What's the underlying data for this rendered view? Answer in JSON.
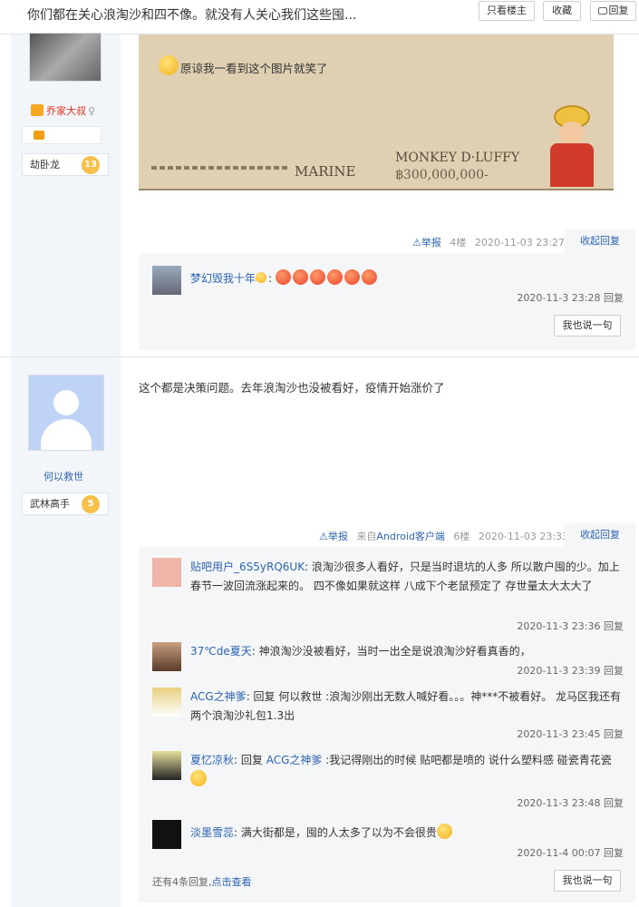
{
  "header": {
    "title": "你们都在关心浪淘沙和四不像。就没有人关心我们这些囤...",
    "only_author": "只看楼主",
    "favorite": "收藏",
    "reply": "回复"
  },
  "post1": {
    "username": "乔家大叔",
    "rank": "劫卧龙",
    "level": "13",
    "content": "原谅我一看到这个图片就笑了",
    "image_marine": "MARINE",
    "image_name": "MONKEY D·LUFFY",
    "image_bounty": "฿300,000,000-",
    "report": "举报",
    "floor": "4楼",
    "date": "2020-11-03 23:27",
    "collapse": "收起回复",
    "replies": [
      {
        "user": "梦幻毁我十年",
        "text": ":",
        "time": "2020-11-3 23:28",
        "reply_label": "回复"
      }
    ],
    "say_button": "我也说一句"
  },
  "post2": {
    "username": "何以救世",
    "rank": "武林高手",
    "level": "5",
    "content": "这个都是决策问题。去年浪淘沙也没被看好，疫情开始涨价了",
    "report": "举报",
    "source": "来自Android客户端",
    "floor": "6楼",
    "date": "2020-11-03 23:33",
    "collapse": "收起回复",
    "replies": [
      {
        "user": "贴吧用户_6S5yRQ6UK",
        "text": ": 浪淘沙很多人看好，只是当时退坑的人多 所以散户囤的少。加上春节一波回流涨起来的。 四不像如果就这样 八成下个老鼠预定了 存世量太大太大了",
        "time": "2020-11-3 23:36",
        "reply_label": "回复"
      },
      {
        "user": "37℃de夏天",
        "text": ": 神浪淘沙没被看好，当时一出全是说浪淘沙好看真香的，",
        "time": "2020-11-3 23:39",
        "reply_label": "回复"
      },
      {
        "user": "ACG之神爹",
        "text": ": 回复 何以救世 :浪淘沙刚出无数人喊好看。。。神***不被看好。 龙马区我还有两个浪淘沙礼包1.3出",
        "time": "2020-11-3 23:45",
        "reply_label": "回复"
      },
      {
        "user": "夏忆凉秋",
        "text": ": 回复 ",
        "mention": "ACG之神爹",
        "text2": " :我记得刚出的时候 贴吧都是喷的 说什么塑料感 碰瓷青花瓷",
        "time": "2020-11-3 23:48",
        "reply_label": "回复"
      },
      {
        "user": "淡墨雪蕊",
        "text": ": 满大街都是，囤的人太多了以为不会很贵",
        "time": "2020-11-4 00:07",
        "reply_label": "回复"
      }
    ],
    "more_replies": "还有4条回复,",
    "click_view": "点击查看",
    "say_button": "我也说一句"
  }
}
